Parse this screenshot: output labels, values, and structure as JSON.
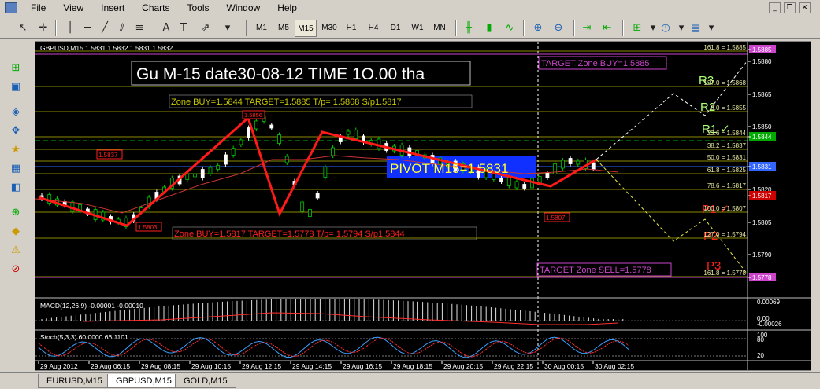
{
  "menu": [
    "File",
    "View",
    "Insert",
    "Charts",
    "Tools",
    "Window",
    "Help"
  ],
  "timeframes": [
    "M1",
    "M5",
    "M15",
    "M30",
    "H1",
    "H4",
    "D1",
    "W1",
    "MN"
  ],
  "active_timeframe": "M15",
  "chart": {
    "header": "GBPUSD,M15  1.5831 1.5832 1.5831 1.5832",
    "title_box": "Gu M-15  date30-08-12 TIME  1O.00 tha",
    "zone_buy_text": "Zone BUY=1.5844 TARGET=1.5885 T/p= 1.5868    S/p1.5817",
    "zone_sell_text": "Zone BUY=1.5817 TARGET=1.5778 T/p= 1.5794     S/p1.5844",
    "pivot_text": "PIVOT M15=1.5831",
    "target_buy": "TARGET Zone BUY=1.5885",
    "target_sell": "TARGET Zone SELL=1.5778",
    "high_label": "1.5856",
    "low_label": "1.5803",
    "left_label": "1.5837",
    "mid_label": "1.5807",
    "r1": "R1 ✓",
    "r2": "R2",
    "r3": "R3",
    "p1": "P1 ✓",
    "p2": "P2",
    "p3": "P3",
    "fib_labels": [
      "161.8 = 1.5885",
      "127.0 = 1.5868",
      "0.0 = 1.5855",
      "23.6 = 1.5844",
      "38.2 = 1.5837",
      "50.0 = 1.5831",
      "61.8 = 1.5825",
      "78.6 = 1.5817",
      "100.0 = 1.5807",
      "127.0 = 1.5794",
      "161.8 = 1.5778"
    ],
    "price_ticks": [
      "1.5885",
      "1.5880",
      "1.5865",
      "1.5850",
      "1.5844",
      "1.5831",
      "1.5820",
      "1.5817",
      "1.5805",
      "1.5790",
      "1.5778"
    ],
    "macd_label": "MACD(12,26,9) -0.00001 -0.00010",
    "macd_ticks": [
      "0.00069",
      "0.00",
      "-0.00026"
    ],
    "stoch_label": "Stoch(5,3,3) 60.0000 66.1101",
    "stoch_ticks": [
      "100",
      "80",
      "20"
    ],
    "time_labels": [
      "29 Aug 2012",
      "29 Aug 06:15",
      "29 Aug 08:15",
      "29 Aug 10:15",
      "29 Aug 12:15",
      "29 Aug 14:15",
      "29 Aug 16:15",
      "29 Aug 18:15",
      "29 Aug 20:15",
      "29 Aug 22:15",
      "30 Aug 00:15",
      "30 Aug 02:15"
    ]
  },
  "tabs": [
    "EURUSD,M15",
    "GBPUSD,M15",
    "GOLD,M15"
  ],
  "active_tab": "GBPUSD,M15",
  "colors": {
    "bull": "#00cc00",
    "bear": "#ffffff",
    "zigzag": "#ff0000",
    "fib": "#c8c800",
    "pivot_bg": "#1030ff",
    "magenta": "#cc44cc"
  }
}
